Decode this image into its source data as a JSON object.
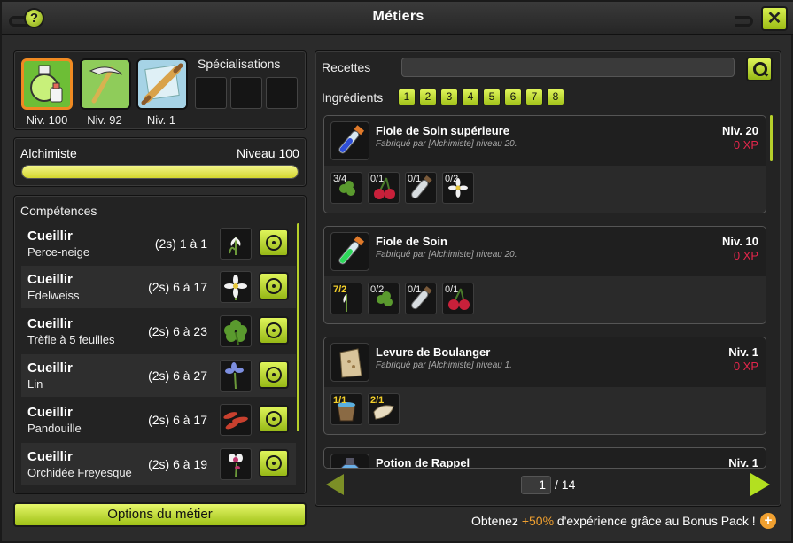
{
  "window": {
    "title": "Métiers",
    "help_label": "?",
    "close_label": "✕"
  },
  "jobs": [
    {
      "level": "Niv. 100",
      "icon": "alchemist-potion-icon",
      "selected": true
    },
    {
      "level": "Niv. 92",
      "icon": "farmer-scythe-icon",
      "selected": false
    },
    {
      "level": "Niv. 1",
      "icon": "baker-rolling-pin-icon",
      "selected": false
    }
  ],
  "specialisations": {
    "title": "Spécialisations"
  },
  "current_job": {
    "name": "Alchimiste",
    "level_text": "Niveau 100",
    "progress_fraction": 1.0
  },
  "competences": {
    "title": "Compétences",
    "items": [
      {
        "verb": "Cueillir",
        "resource": "Perce-neige",
        "range": "(2s) 1 à 1",
        "icon": "snowdrop-flower-icon"
      },
      {
        "verb": "Cueillir",
        "resource": "Edelweiss",
        "range": "(2s) 6 à 17",
        "icon": "edelweiss-flower-icon"
      },
      {
        "verb": "Cueillir",
        "resource": "Trèfle à 5 feuilles",
        "range": "(2s) 6 à 23",
        "icon": "clover-icon"
      },
      {
        "verb": "Cueillir",
        "resource": "Lin",
        "range": "(2s) 6 à 27",
        "icon": "flax-flower-icon"
      },
      {
        "verb": "Cueillir",
        "resource": "Pandouille",
        "range": "(2s) 6 à 17",
        "icon": "pandouille-icon"
      },
      {
        "verb": "Cueillir",
        "resource": "Orchidée Freyesque",
        "range": "(2s) 6 à 19",
        "icon": "orchid-icon"
      }
    ]
  },
  "options_button": "Options du métier",
  "recettes": {
    "label": "Recettes",
    "search_value": ""
  },
  "ingredients_filter": {
    "label": "Ingrédients",
    "buttons": [
      "1",
      "2",
      "3",
      "4",
      "5",
      "6",
      "7",
      "8"
    ]
  },
  "recipes": [
    {
      "name": "Fiole de Soin supérieure",
      "maker": "Fabriqué par [Alchimiste] niveau 20.",
      "level": "Niv. 20",
      "xp": "0 XP",
      "icon": "blue-vial-icon",
      "ingredients": [
        {
          "qty": "3/4",
          "ok": false,
          "icon": "clover-icon"
        },
        {
          "qty": "0/1",
          "ok": false,
          "icon": "cherry-icon"
        },
        {
          "qty": "0/1",
          "ok": false,
          "icon": "empty-vial-icon"
        },
        {
          "qty": "0/2",
          "ok": false,
          "icon": "edelweiss-flower-icon"
        }
      ]
    },
    {
      "name": "Fiole de Soin",
      "maker": "Fabriqué par [Alchimiste] niveau 20.",
      "level": "Niv. 10",
      "xp": "0 XP",
      "icon": "green-vial-icon",
      "ingredients": [
        {
          "qty": "7/2",
          "ok": true,
          "icon": "snowdrop-flower-icon"
        },
        {
          "qty": "0/2",
          "ok": false,
          "icon": "clover-icon"
        },
        {
          "qty": "0/1",
          "ok": false,
          "icon": "empty-vial-icon"
        },
        {
          "qty": "0/1",
          "ok": false,
          "icon": "cherry-icon"
        }
      ]
    },
    {
      "name": "Levure de Boulanger",
      "maker": "Fabriqué par [Alchimiste] niveau 1.",
      "level": "Niv. 1",
      "xp": "0 XP",
      "icon": "yeast-sack-icon",
      "ingredients": [
        {
          "qty": "1/1",
          "ok": true,
          "icon": "water-bucket-icon"
        },
        {
          "qty": "2/1",
          "ok": true,
          "icon": "flour-icon"
        }
      ]
    },
    {
      "name": "Potion de Rappel",
      "maker": "",
      "level": "Niv. 1",
      "xp": "",
      "icon": "recall-potion-icon",
      "ingredients": []
    }
  ],
  "pagination": {
    "current": "1",
    "total": "/ 14"
  },
  "bonus": {
    "prefix": "Obtenez ",
    "highlight": "+50%",
    "suffix": " d'expérience grâce au Bonus Pack !",
    "plus": "+"
  },
  "colors": {
    "accent": "#c6e02b",
    "xp_red": "#e2264b",
    "bonus_orange": "#f0a030",
    "level_bar": "#e8ea5c"
  }
}
